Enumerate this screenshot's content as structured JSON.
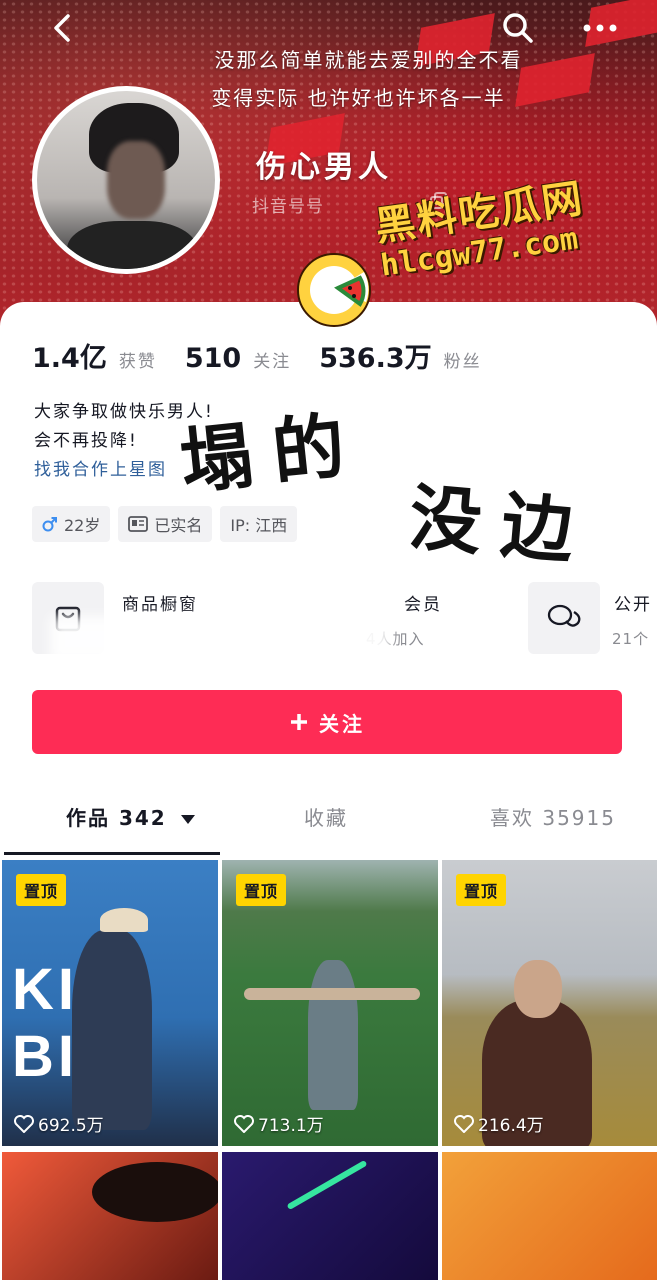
{
  "header": {
    "bio_line_1": "没那么简单就能去爱别的全不看",
    "bio_line_2": "变得实际 也许好也许坏各一半",
    "nickname": "伤心男人",
    "douyin_id": "抖音号号",
    "icons": {
      "back": "back-arrow-icon",
      "search": "search-icon",
      "more": "more-dots-icon",
      "copy": "copy-icon"
    }
  },
  "watermark": {
    "title": "黑料吃瓜网",
    "url": "hlcgw77.com",
    "icon": "watermelon-logo-icon"
  },
  "stats": [
    {
      "value": "1.4亿",
      "label": "获赞"
    },
    {
      "value": "510",
      "label": "关注"
    },
    {
      "value": "536.3万",
      "label": "粉丝"
    }
  ],
  "intro": {
    "line_1": "大家争取做快乐男人!",
    "line_2": "会不再投降!",
    "link": "找我合作上星图"
  },
  "overlay": {
    "word_1": "塌的",
    "word_2": "没边"
  },
  "tags": [
    {
      "icon": "male-icon",
      "text": "22岁"
    },
    {
      "icon": "id-card-icon",
      "text": "已实名"
    },
    {
      "icon": "",
      "text": "IP: 江西"
    }
  ],
  "services": {
    "shop": {
      "title": "商品橱窗",
      "icon": "shopping-bag-icon"
    },
    "group": {
      "title": "会员",
      "subtitle": "4人加入"
    },
    "chat": {
      "title": "公开",
      "subtitle": "21个",
      "icon": "chat-bubbles-icon"
    }
  },
  "follow_button": {
    "label": "关注",
    "icon": "plus-icon",
    "color": "#fe2c55"
  },
  "tabs": [
    {
      "label": "作品 342",
      "active": true
    },
    {
      "label": "收藏",
      "active": false
    },
    {
      "label": "喜欢 35915",
      "active": false
    }
  ],
  "videos": [
    {
      "pinned": true,
      "pin_label": "置顶",
      "likes": "692.5万",
      "overlay_text": "KILL BILL"
    },
    {
      "pinned": true,
      "pin_label": "置顶",
      "likes": "713.1万"
    },
    {
      "pinned": true,
      "pin_label": "置顶",
      "likes": "216.4万"
    },
    {
      "pinned": false
    },
    {
      "pinned": false
    },
    {
      "pinned": false
    }
  ],
  "colors": {
    "accent": "#fe2c55",
    "pin_badge": "#ffd400",
    "link": "#2f5f9a",
    "watermark": "#ffd23f"
  }
}
